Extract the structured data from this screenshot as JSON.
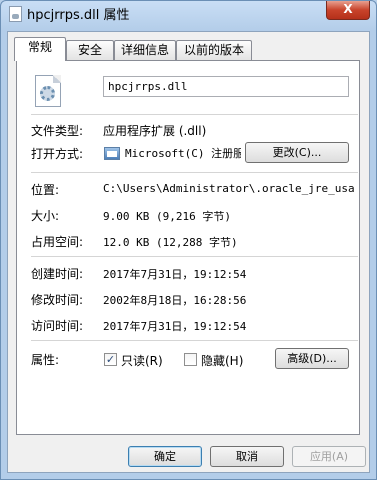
{
  "window": {
    "title": "hpcjrrps.dll 属性",
    "close_label": "X"
  },
  "tabs": [
    {
      "label": "常规",
      "active": true
    },
    {
      "label": "安全",
      "active": false
    },
    {
      "label": "详细信息",
      "active": false
    },
    {
      "label": "以前的版本",
      "active": false
    }
  ],
  "general": {
    "icon": "dll-file-gear-icon",
    "file_name": "hpcjrrps.dll",
    "file_type_label": "文件类型:",
    "file_type_value": "应用程序扩展 (.dll)",
    "open_with_label": "打开方式:",
    "open_with_icon": "application-window-icon",
    "open_with_value": "Microsoft(C) 注册服",
    "change_button": "更改(C)...",
    "location_label": "位置:",
    "location_value": "C:\\Users\\Administrator\\.oracle_jre_usage\\",
    "size_label": "大小:",
    "size_value": "9.00 KB (9,216 字节)",
    "size_on_disk_label": "占用空间:",
    "size_on_disk_value": "12.0 KB (12,288 字节)",
    "created_label": "创建时间:",
    "created_value": "2017年7月31日，19:12:54",
    "modified_label": "修改时间:",
    "modified_value": "2002年8月18日，16:28:56",
    "accessed_label": "访问时间:",
    "accessed_value": "2017年7月31日，19:12:54",
    "attributes_label": "属性:",
    "readonly_label": "只读(R)",
    "readonly_checked": true,
    "hidden_label": "隐藏(H)",
    "hidden_checked": false,
    "advanced_button": "高级(D)..."
  },
  "footer": {
    "ok_button": "确定",
    "cancel_button": "取消",
    "apply_button": "应用(A)"
  }
}
